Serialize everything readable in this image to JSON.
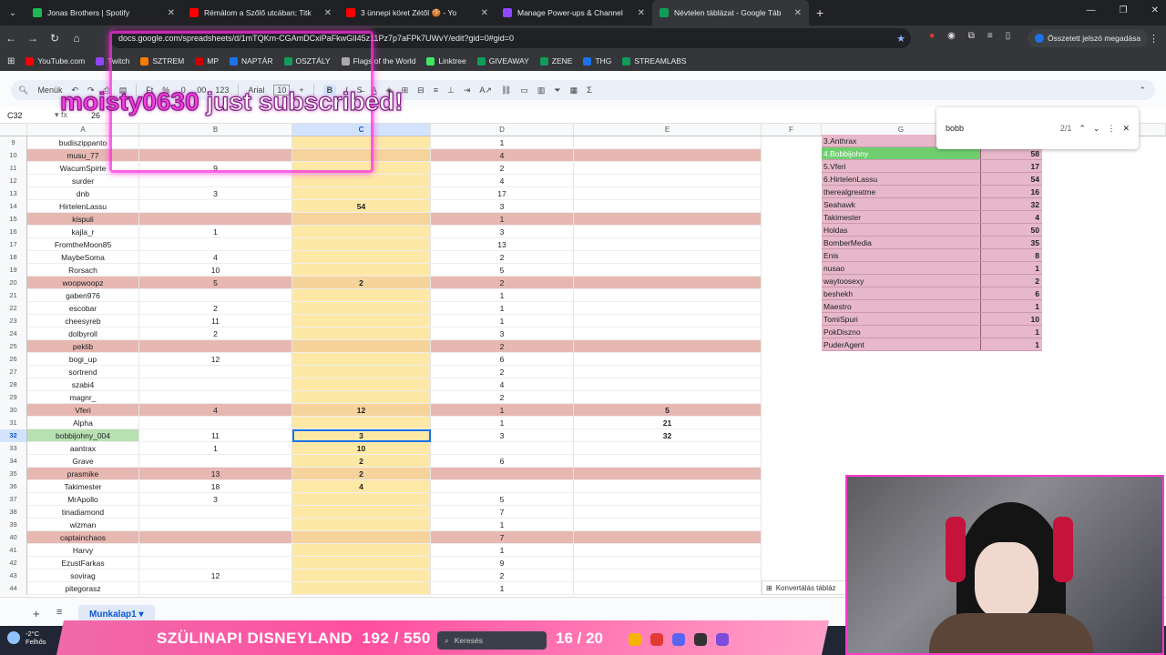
{
  "tabs": [
    {
      "title": "Jonas Brothers | Spotify",
      "color": "#1db954"
    },
    {
      "title": "Rémálom a Szőlő utcában; Titk",
      "color": "#ff0000"
    },
    {
      "title": "3 ünnepi köret Zétől 🍪 - Yo",
      "color": "#ff0000"
    },
    {
      "title": "Manage Power-ups & Channel",
      "color": "#9146ff"
    },
    {
      "title": "Névtelen táblázat - Google Táb",
      "color": "#0f9d58"
    }
  ],
  "url": "docs.google.com/spreadsheets/d/1mTQKm-CGAmDCxiPaFkwGlI45z11Pz7p7aFPk7UWvY/edit?gid=0#gid=0",
  "profile_label": "Összetett jelszó megadása",
  "bookmarks": [
    {
      "label": "YouTube.com",
      "color": "#ff0000"
    },
    {
      "label": "Twitch",
      "color": "#9146ff"
    },
    {
      "label": "SZTREM",
      "color": "#ff7b00"
    },
    {
      "label": "MP",
      "color": "#c00"
    },
    {
      "label": "NAPTÁR",
      "color": "#1a73e8"
    },
    {
      "label": "OSZTÁLY",
      "color": "#0f9d58"
    },
    {
      "label": "Flags of the World",
      "color": "#aaa"
    },
    {
      "label": "Linktree",
      "color": "#43e660"
    },
    {
      "label": "GIVEAWAY",
      "color": "#0f9d58"
    },
    {
      "label": "ZENE",
      "color": "#0f9d58"
    },
    {
      "label": "THG",
      "color": "#1a73e8"
    },
    {
      "label": "STREAMLABS",
      "color": "#0f9d58"
    }
  ],
  "toolbar": {
    "menus": "Menük",
    "font": "Arial",
    "fontsize": "10",
    "bold": "B",
    "italic": "I",
    "currency": "Ft",
    "percent": "%",
    "dec1": ".0",
    "dec2": ".00",
    "fmt": "123"
  },
  "overlay": {
    "user": "moisty0630",
    "rest": " just subscribed!"
  },
  "formula": {
    "ref": "C32",
    "value": "26"
  },
  "columns": [
    "A",
    "B",
    "C",
    "D",
    "E",
    "F",
    "G"
  ],
  "rows": [
    {
      "n": "9",
      "a": "budiszippanto",
      "b": "",
      "c": "",
      "d": "1",
      "e": "",
      "s": ""
    },
    {
      "n": "10",
      "a": "musu_77",
      "b": "",
      "c": "",
      "d": "4",
      "e": "",
      "s": "red"
    },
    {
      "n": "11",
      "a": "WacumSpirte",
      "b": "9",
      "c": "",
      "d": "2",
      "e": "",
      "s": ""
    },
    {
      "n": "12",
      "a": "surder",
      "b": "",
      "c": "",
      "d": "4",
      "e": "",
      "s": ""
    },
    {
      "n": "13",
      "a": "dnb",
      "b": "3",
      "c": "",
      "d": "17",
      "e": "",
      "s": ""
    },
    {
      "n": "14",
      "a": "HirtelenLassu",
      "b": "",
      "c": "54",
      "d": "3",
      "e": "",
      "s": ""
    },
    {
      "n": "15",
      "a": "kispuli",
      "b": "",
      "c": "",
      "d": "1",
      "e": "",
      "s": "red"
    },
    {
      "n": "16",
      "a": "kajla_r",
      "b": "1",
      "c": "",
      "d": "3",
      "e": "",
      "s": ""
    },
    {
      "n": "17",
      "a": "FromtheMoon85",
      "b": "",
      "c": "",
      "d": "13",
      "e": "",
      "s": ""
    },
    {
      "n": "18",
      "a": "MaybeSoma",
      "b": "4",
      "c": "",
      "d": "2",
      "e": "",
      "s": ""
    },
    {
      "n": "19",
      "a": "Rorsach",
      "b": "10",
      "c": "",
      "d": "5",
      "e": "",
      "s": ""
    },
    {
      "n": "20",
      "a": "woopwoopz",
      "b": "5",
      "c": "2",
      "d": "2",
      "e": "",
      "s": "red"
    },
    {
      "n": "21",
      "a": "gaben976",
      "b": "",
      "c": "",
      "d": "1",
      "e": "",
      "s": ""
    },
    {
      "n": "22",
      "a": "escobar",
      "b": "2",
      "c": "",
      "d": "1",
      "e": "",
      "s": ""
    },
    {
      "n": "23",
      "a": "cheesyreb",
      "b": "11",
      "c": "",
      "d": "1",
      "e": "",
      "s": ""
    },
    {
      "n": "24",
      "a": "dolbyroll",
      "b": "2",
      "c": "",
      "d": "3",
      "e": "",
      "s": ""
    },
    {
      "n": "25",
      "a": "peklib",
      "b": "",
      "c": "",
      "d": "2",
      "e": "",
      "s": "red"
    },
    {
      "n": "26",
      "a": "bogi_up",
      "b": "12",
      "c": "",
      "d": "6",
      "e": "",
      "s": ""
    },
    {
      "n": "27",
      "a": "sortrend",
      "b": "",
      "c": "",
      "d": "2",
      "e": "",
      "s": ""
    },
    {
      "n": "28",
      "a": "szabi4",
      "b": "",
      "c": "",
      "d": "4",
      "e": "",
      "s": ""
    },
    {
      "n": "29",
      "a": "magnr_",
      "b": "",
      "c": "",
      "d": "2",
      "e": "",
      "s": ""
    },
    {
      "n": "30",
      "a": "Vferi",
      "b": "4",
      "c": "12",
      "d": "1",
      "e": "5",
      "s": "red"
    },
    {
      "n": "31",
      "a": "Alpha",
      "b": "",
      "c": "",
      "d": "1",
      "e": "21",
      "s": ""
    },
    {
      "n": "32",
      "a": "bobbijohny_004",
      "b": "11",
      "c": "3",
      "d": "3",
      "e": "32",
      "s": "green"
    },
    {
      "n": "33",
      "a": "aantrax",
      "b": "1",
      "c": "10",
      "d": "",
      "e": "",
      "s": ""
    },
    {
      "n": "34",
      "a": "Grave",
      "b": "",
      "c": "2",
      "d": "6",
      "e": "",
      "s": ""
    },
    {
      "n": "35",
      "a": "prasmike",
      "b": "13",
      "c": "2",
      "d": "",
      "e": "",
      "s": "red"
    },
    {
      "n": "36",
      "a": "Takimester",
      "b": "18",
      "c": "4",
      "d": "",
      "e": "",
      "s": ""
    },
    {
      "n": "37",
      "a": "MrApollo",
      "b": "3",
      "c": "",
      "d": "5",
      "e": "",
      "s": ""
    },
    {
      "n": "38",
      "a": "tinadiamond",
      "b": "",
      "c": "",
      "d": "7",
      "e": "",
      "s": ""
    },
    {
      "n": "39",
      "a": "wizman",
      "b": "",
      "c": "",
      "d": "1",
      "e": "",
      "s": ""
    },
    {
      "n": "40",
      "a": "captainchaos",
      "b": "",
      "c": "",
      "d": "7",
      "e": "",
      "s": "red"
    },
    {
      "n": "41",
      "a": "Harvy",
      "b": "",
      "c": "",
      "d": "1",
      "e": "",
      "s": ""
    },
    {
      "n": "42",
      "a": "EzustFarkas",
      "b": "",
      "c": "",
      "d": "9",
      "e": "",
      "s": ""
    },
    {
      "n": "43",
      "a": "sovirag",
      "b": "12",
      "c": "",
      "d": "2",
      "e": "",
      "s": ""
    },
    {
      "n": "44",
      "a": "pitegorasz",
      "b": "",
      "c": "",
      "d": "1",
      "e": "",
      "s": ""
    }
  ],
  "ranking": [
    {
      "name": "3.Anthrax",
      "value": "",
      "hl": false
    },
    {
      "name": "4.Bobbijohny",
      "value": "58",
      "hl": true
    },
    {
      "name": "5.Vferi",
      "value": "17",
      "hl": false
    },
    {
      "name": "6.HirtelenLassu",
      "value": "54",
      "hl": false
    },
    {
      "name": "therealgreatme",
      "value": "16",
      "hl": false
    },
    {
      "name": "Seahawk",
      "value": "32",
      "hl": false
    },
    {
      "name": "Takimester",
      "value": "4",
      "hl": false
    },
    {
      "name": "Holdas",
      "value": "50",
      "hl": false
    },
    {
      "name": "BomberMedia",
      "value": "35",
      "hl": false
    },
    {
      "name": "Enis",
      "value": "8",
      "hl": false
    },
    {
      "name": "nusao",
      "value": "1",
      "hl": false
    },
    {
      "name": "waytoosexy",
      "value": "2",
      "hl": false
    },
    {
      "name": "beshekh",
      "value": "6",
      "hl": false
    },
    {
      "name": "Maestro",
      "value": "1",
      "hl": false
    },
    {
      "name": "TomiSpuri",
      "value": "10",
      "hl": false
    },
    {
      "name": "PokDiszno",
      "value": "1",
      "hl": false
    },
    {
      "name": "PuderAgent",
      "value": "1",
      "hl": false
    }
  ],
  "find": {
    "query": "bobb",
    "count": "2/1"
  },
  "convert_label": "Konvertálás tábláz",
  "sheet_tab": "Munkalap1",
  "weather": {
    "temp": "-2°C",
    "cond": "Felhős"
  },
  "banner": {
    "title": "SZÜLINAPI DISNEYLAND",
    "progress": "192 / 550",
    "count": "16 / 20"
  },
  "taskbar_search": "Keresés"
}
